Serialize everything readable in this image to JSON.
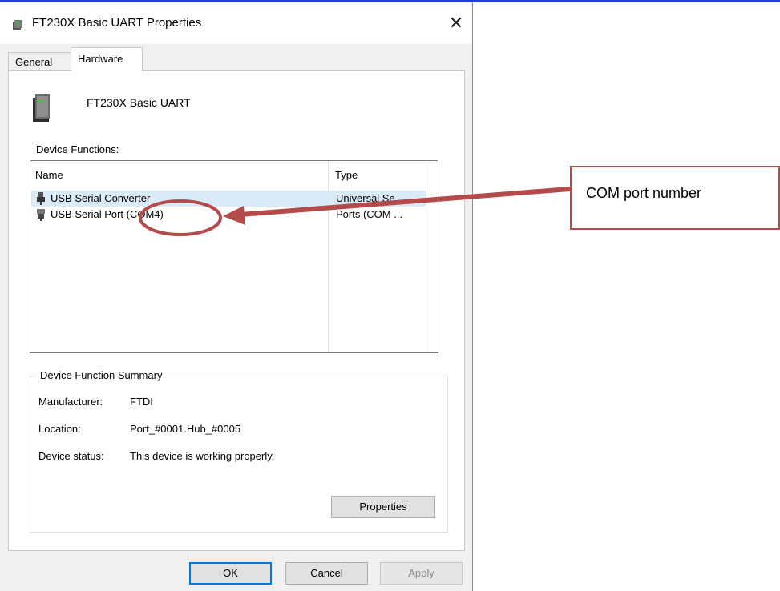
{
  "window": {
    "title": "FT230X Basic UART Properties",
    "close_glyph": "✕"
  },
  "tabs": [
    {
      "label": "General"
    },
    {
      "label": "Hardware"
    }
  ],
  "device": {
    "name": "FT230X Basic UART",
    "icon": "device-icon"
  },
  "functions": {
    "label": "Device Functions:",
    "columns": [
      "Name",
      "Type"
    ],
    "rows": [
      {
        "name": "USB Serial Converter",
        "type": "Universal Se...",
        "icon": "usb-plug-icon"
      },
      {
        "name": "USB Serial Port (COM4)",
        "type": "Ports (COM ...",
        "icon": "serial-port-icon"
      }
    ]
  },
  "summary": {
    "legend": "Device Function Summary",
    "manufacturer_label": "Manufacturer:",
    "manufacturer_value": "FTDI",
    "location_label": "Location:",
    "location_value": "Port_#0001.Hub_#0005",
    "status_label": "Device status:",
    "status_value": "This device is working properly.",
    "properties_label": "Properties"
  },
  "buttons": {
    "ok": "OK",
    "cancel": "Cancel",
    "apply": "Apply"
  },
  "annotation": {
    "text": "COM port number",
    "color": "#b44a4a"
  },
  "colors": {
    "selection": "#d9ebf9",
    "accent": "#0078d7",
    "top_border": "#1f3fd6"
  }
}
